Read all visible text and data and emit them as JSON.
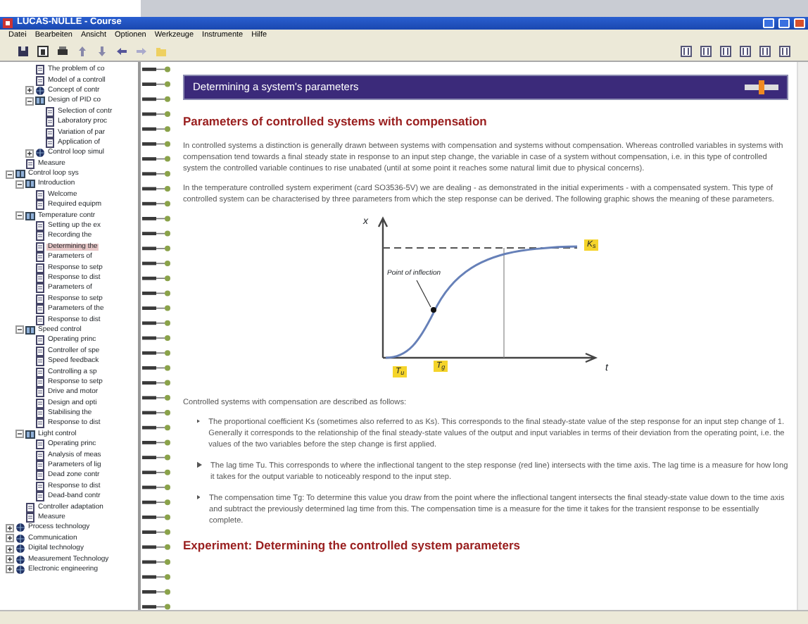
{
  "window": {
    "title": "LUCAS-NÜLLE - Course"
  },
  "menu": [
    "Datei",
    "Bearbeiten",
    "Ansicht",
    "Optionen",
    "Werkzeuge",
    "Instrumente",
    "Hilfe"
  ],
  "tree": {
    "items": [
      {
        "children": [
          {
            "children": [
              {
                "label": "The problem of co",
                "kind": "page",
                "selected": false
              },
              {
                "label": "Model of a controll",
                "kind": "page",
                "selected": false
              },
              {
                "label": "Concept of contr",
                "kind": "globe",
                "expanded": false,
                "selected": false
              },
              {
                "label": "Design of PID co",
                "kind": "book",
                "expanded": true,
                "selected": false,
                "children": [
                  {
                    "label": "Selection of contr",
                    "kind": "page",
                    "selected": false
                  },
                  {
                    "label": "Laboratory proc",
                    "kind": "page",
                    "selected": false
                  },
                  {
                    "label": "Variation of par",
                    "kind": "page",
                    "selected": false
                  },
                  {
                    "label": "Application of",
                    "kind": "page",
                    "selected": false
                  }
                ]
              },
              {
                "label": "Control loop simul",
                "kind": "globe",
                "expanded": false,
                "selected": false
              }
            ]
          },
          {
            "label": "Measure",
            "kind": "page",
            "selected": false
          }
        ]
      },
      {
        "label": "Control loop sys",
        "kind": "book",
        "expanded": true,
        "selected": false,
        "children": [
          {
            "label": "Introduction",
            "kind": "book",
            "expanded": true,
            "selected": false,
            "children": [
              {
                "label": "Welcome",
                "kind": "page",
                "selected": false
              },
              {
                "label": "Required equipm",
                "kind": "page",
                "selected": false
              }
            ]
          },
          {
            "label": "Temperature contr",
            "kind": "book",
            "expanded": true,
            "selected": false,
            "children": [
              {
                "label": "Setting up the ex",
                "kind": "page",
                "selected": false
              },
              {
                "label": "Recording the",
                "kind": "page",
                "selected": false
              },
              {
                "label": "Determining the",
                "kind": "page",
                "selected": true
              },
              {
                "label": "Parameters of",
                "kind": "page",
                "selected": false
              },
              {
                "label": "Response to setp",
                "kind": "page",
                "selected": false
              },
              {
                "label": "Response to dist",
                "kind": "page",
                "selected": false
              },
              {
                "label": "Parameters of",
                "kind": "page",
                "selected": false
              },
              {
                "label": "Response to setp",
                "kind": "page",
                "selected": false
              },
              {
                "label": "Parameters of the",
                "kind": "page",
                "selected": false
              },
              {
                "label": "Response to dist",
                "kind": "page",
                "selected": false
              }
            ]
          },
          {
            "label": "Speed control",
            "kind": "book",
            "expanded": true,
            "selected": false,
            "children": [
              {
                "label": "Operating princ",
                "kind": "page",
                "selected": false
              },
              {
                "label": "Controller of spe",
                "kind": "page",
                "selected": false
              },
              {
                "label": "Speed feedback",
                "kind": "page",
                "selected": false
              },
              {
                "label": "Controlling a sp",
                "kind": "page",
                "selected": false
              },
              {
                "label": "Response to setp",
                "kind": "page",
                "selected": false
              },
              {
                "label": "Drive and motor",
                "kind": "page",
                "selected": false
              },
              {
                "label": "Design and opti",
                "kind": "page",
                "selected": false
              },
              {
                "label": "Stabilising the",
                "kind": "page",
                "selected": false
              },
              {
                "label": "Response to dist",
                "kind": "page",
                "selected": false
              }
            ]
          },
          {
            "label": "Light control",
            "kind": "book",
            "expanded": true,
            "selected": false,
            "children": [
              {
                "label": "Operating princ",
                "kind": "page",
                "selected": false
              },
              {
                "label": "Analysis of meas",
                "kind": "page",
                "selected": false
              },
              {
                "label": "Parameters of lig",
                "kind": "page",
                "selected": false
              },
              {
                "label": "Dead zone contr",
                "kind": "page",
                "selected": false
              },
              {
                "label": "Response to dist",
                "kind": "page",
                "selected": false
              },
              {
                "label": "Dead-band contr",
                "kind": "page",
                "selected": false
              }
            ]
          },
          {
            "label": "Controller adaptation",
            "kind": "page",
            "selected": false
          },
          {
            "label": "Measure",
            "kind": "page",
            "selected": false
          }
        ]
      },
      {
        "label": "Process technology",
        "kind": "globe",
        "expanded": false,
        "selected": false
      },
      {
        "label": "Communication",
        "kind": "globe",
        "expanded": false,
        "selected": false
      },
      {
        "label": "Digital technology",
        "kind": "globe",
        "expanded": false,
        "selected": false
      },
      {
        "label": "Measurement Technology",
        "kind": "globe",
        "expanded": false,
        "selected": false
      },
      {
        "label": "Electronic engineering",
        "kind": "globe",
        "expanded": false,
        "selected": false
      }
    ]
  },
  "page": {
    "title": "Determining a system's parameters",
    "heading": "Parameters of controlled systems with compensation",
    "paragraphs": [
      "In controlled systems a distinction is generally drawn between systems with compensation and systems without compensation. Whereas controlled variables in systems with compensation tend towards a final steady state in response to an input step change, the variable in case of a system without compensation, i.e. in this type of controlled system the controlled variable continues to rise unabated (until at some point it reaches some natural limit due to physical concerns).",
      "In the temperature controlled system experiment (card SO3536-5V) we are dealing - as demonstrated in the initial experiments - with a compensated system. This type of controlled system can be characterised by three parameters from which the step response can be derived. The following graphic shows the meaning of these parameters."
    ],
    "figure": {
      "y_label": "x",
      "x_label": "t",
      "point_label": "Point of inflection",
      "tags": [
        "K$_{s}$",
        "T$_{u}$",
        "T$_{g}$"
      ]
    },
    "intro": "Controlled systems with compensation are described as follows:",
    "bullets": [
      "The proportional coefficient Ks (sometimes also referred to as Ks). This corresponds to the final steady-state value of the step response for an input step change of 1. Generally it corresponds to the relationship of the final steady-state values of the output and input variables in terms of their deviation from the operating point, i.e. the values of the two variables before the step change is first applied.",
      "The lag time Tu. This corresponds to where the inflectional tangent to the step response (red line) intersects with the time axis. The lag time is a measure for how long it takes for the output variable to noticeably respond to the input step.",
      "The compensation time Tg: To determine this value you draw from the point where the inflectional tangent intersects the final steady-state value down to the time axis and subtract the previously determined lag time from this. The compensation time is a measure for the time it takes for the transient response to be essentially complete."
    ],
    "heading2": "Experiment: Determining the controlled system parameters"
  }
}
